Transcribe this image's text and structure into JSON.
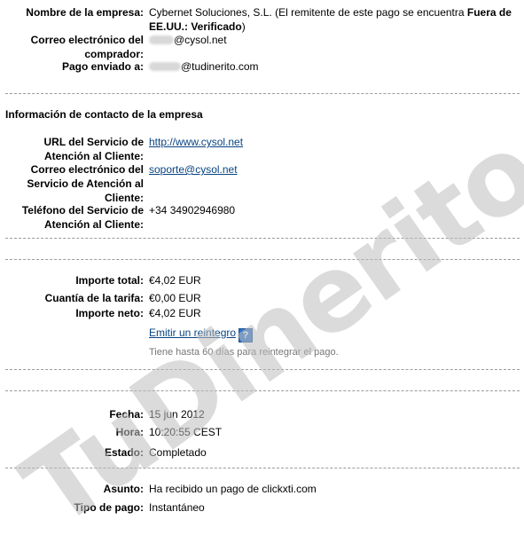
{
  "merchant": {
    "name_label": "Nombre de la empresa:",
    "name_value": "Cybernet Soluciones, S.L. (El remitente de este pago se encuentra ",
    "name_value_bold": "Fuera de EE.UU.: Verificado",
    "name_value_end": ")",
    "buyer_email_label": "Correo electrónico del comprador:",
    "buyer_email_domain": "@cysol.net",
    "sent_to_label": "Pago enviado a:",
    "sent_to_domain": "@tudinerito.com"
  },
  "contact": {
    "section_title": "Información de contacto de la empresa",
    "service_url_label": "URL del Servicio de Atención al Cliente:",
    "service_url_value": "http://www.cysol.net",
    "service_email_label": "Correo electrónico del Servicio de Atención al Cliente:",
    "service_email_value": "soporte@cysol.net",
    "service_phone_label": "Teléfono del Servicio de Atención al Cliente:",
    "service_phone_value": "+34 34902946980"
  },
  "amounts": {
    "total_label": "Importe total:",
    "total_value": "€4,02 EUR",
    "fee_label": "Cuantía de la tarifa:",
    "fee_value": "€0,00 EUR",
    "net_label": "Importe neto:",
    "net_value": "€4,02 EUR",
    "refund_link": "Emitir un reintegro",
    "help_icon_glyph": "?",
    "refund_note": "Tiene hasta 60 días para reintegrar el pago."
  },
  "status": {
    "date_label": "Fecha:",
    "date_value": "15 jun 2012",
    "time_label": "Hora:",
    "time_value": "10:20:55 CEST",
    "state_label": "Estado:",
    "state_value": "Completado"
  },
  "details": {
    "subject_label": "Asunto:",
    "subject_value": "Ha recibido un pago de clickxti.com",
    "type_label": "Tipo de pago:",
    "type_value": "Instantáneo"
  },
  "watermark_text": "TuDinerito.com",
  "colors": {
    "link": "#084482",
    "separator": "#9a9a9a",
    "help_icon": "#2f73c9"
  }
}
